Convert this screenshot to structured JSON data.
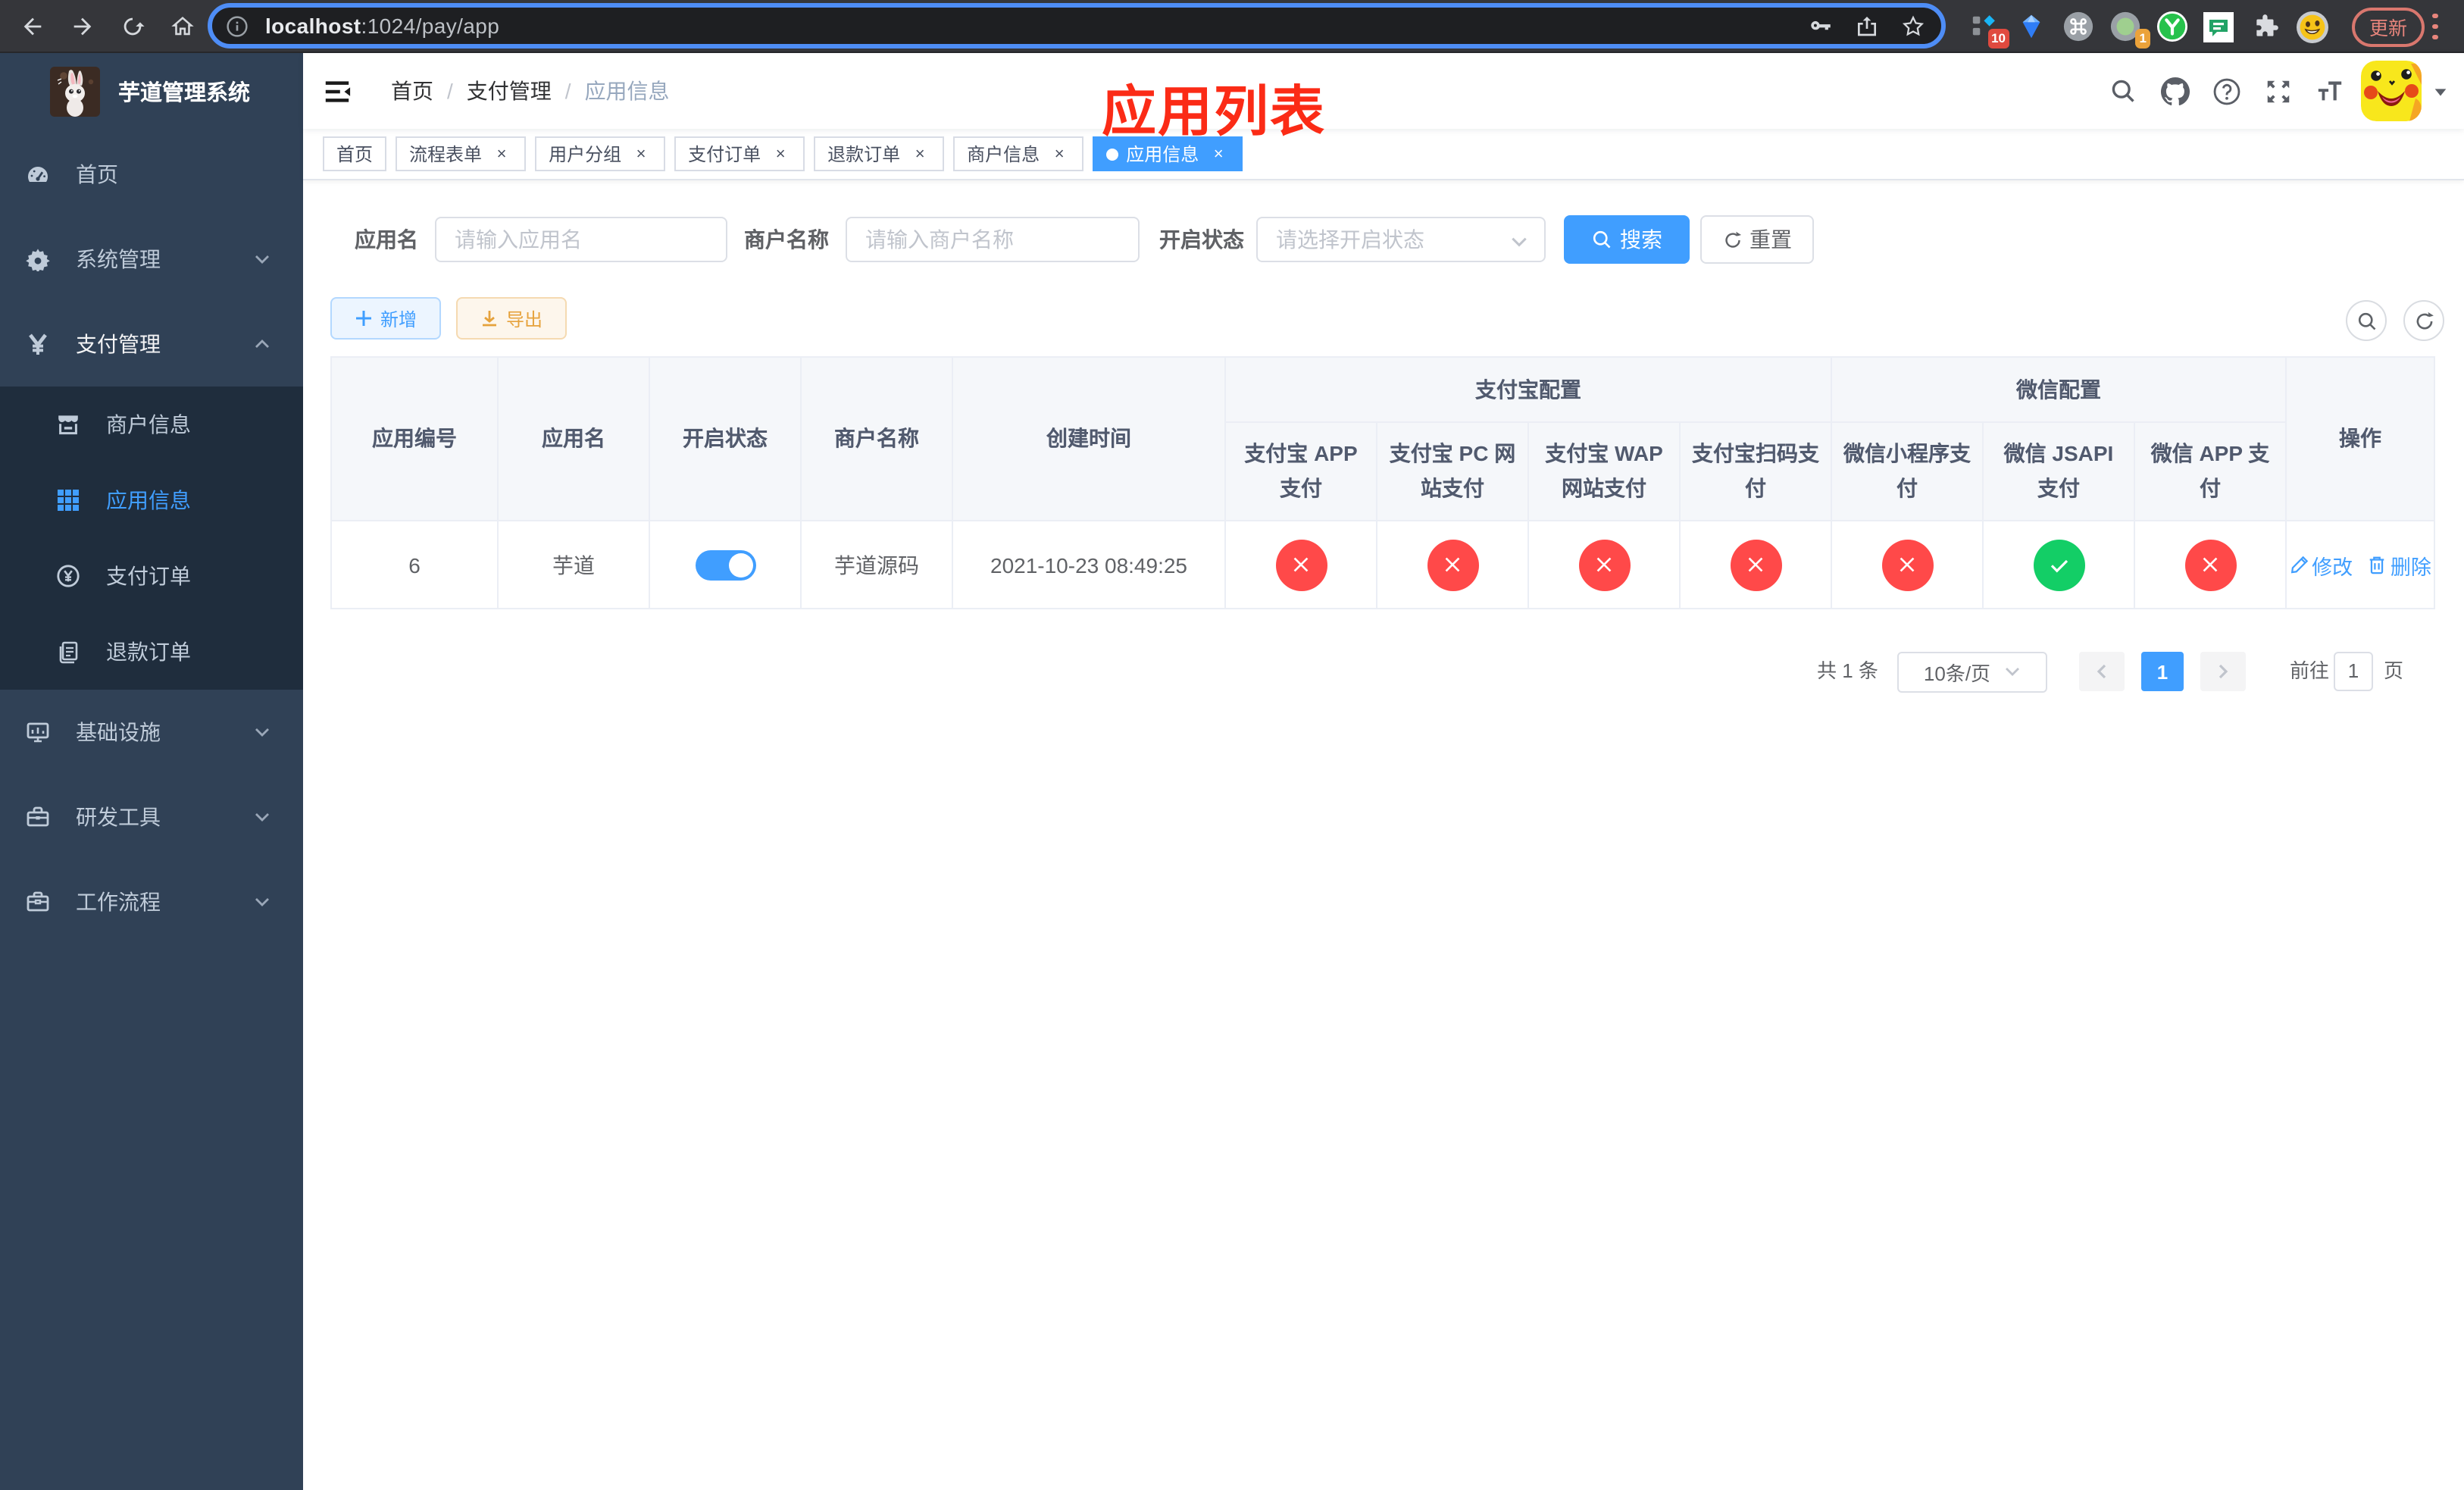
{
  "browser": {
    "url_host": "localhost",
    "url_rest": ":1024/pay/app",
    "update_label": "更新",
    "extension_badge_count": "10",
    "notification_badge_count": "1"
  },
  "sidebar": {
    "logo_title": "芋道管理系统",
    "items": [
      {
        "label": "首页",
        "icon": "dashboard-icon"
      },
      {
        "label": "系统管理",
        "icon": "gear-icon",
        "state": "collapsed"
      },
      {
        "label": "支付管理",
        "icon": "yen-icon",
        "state": "expanded"
      },
      {
        "label": "基础设施",
        "icon": "monitor-icon",
        "state": "collapsed"
      },
      {
        "label": "研发工具",
        "icon": "toolbox-icon",
        "state": "collapsed"
      },
      {
        "label": "工作流程",
        "icon": "briefcase-icon",
        "state": "collapsed"
      }
    ],
    "submenu": [
      {
        "label": "商户信息",
        "icon": "store-icon",
        "active": false
      },
      {
        "label": "应用信息",
        "icon": "grid-icon",
        "active": true
      },
      {
        "label": "支付订单",
        "icon": "coin-icon",
        "active": false
      },
      {
        "label": "退款订单",
        "icon": "document-icon",
        "active": false
      }
    ]
  },
  "navbar": {
    "breadcrumb": {
      "0": "首页",
      "1": "支付管理",
      "2": "应用信息",
      "separator": "/"
    },
    "annotation": "应用列表"
  },
  "tags": [
    {
      "label": "首页",
      "closable": false,
      "active": false
    },
    {
      "label": "流程表单",
      "closable": true,
      "active": false
    },
    {
      "label": "用户分组",
      "closable": true,
      "active": false
    },
    {
      "label": "支付订单",
      "closable": true,
      "active": false
    },
    {
      "label": "退款订单",
      "closable": true,
      "active": false
    },
    {
      "label": "商户信息",
      "closable": true,
      "active": false
    },
    {
      "label": "应用信息",
      "closable": true,
      "active": true
    }
  ],
  "filters": {
    "app_name_label": "应用名",
    "app_name_placeholder": "请输入应用名",
    "merchant_label": "商户名称",
    "merchant_placeholder": "请输入商户名称",
    "status_label": "开启状态",
    "status_placeholder": "请选择开启状态",
    "search_label": "搜索",
    "reset_label": "重置"
  },
  "toolbar": {
    "add_label": "新增",
    "export_label": "导出"
  },
  "table": {
    "headers": {
      "app_id": "应用编号",
      "app_name": "应用名",
      "status": "开启状态",
      "merchant": "商户名称",
      "created": "创建时间",
      "alipay_group": "支付宝配置",
      "wechat_group": "微信配置",
      "alipay_app": "支付宝 APP 支付",
      "alipay_pc": "支付宝 PC 网站支付",
      "alipay_wap": "支付宝 WAP 网站支付",
      "alipay_qr": "支付宝扫码支付",
      "wechat_lite": "微信小程序支付",
      "wechat_jsapi": "微信 JSAPI 支付",
      "wechat_app": "微信 APP 支付",
      "operation": "操作"
    },
    "row": {
      "app_id": "6",
      "app_name": "芋道",
      "status_on": true,
      "merchant": "芋道源码",
      "created": "2021-10-23 08:49:25",
      "configs": [
        "off",
        "off",
        "off",
        "off",
        "off",
        "on",
        "off"
      ],
      "edit_label": "修改",
      "delete_label": "删除"
    }
  },
  "pagination": {
    "total_text": "共 1 条",
    "page_size_text": "10条/页",
    "current_page": "1",
    "goto_label": "前往",
    "goto_value": "1",
    "page_unit": "页"
  },
  "colors": {
    "primary": "#409eff",
    "danger_circle": "#ff4949",
    "success_circle": "#13ce66",
    "sidebar_bg": "#304156",
    "submenu_bg": "#1f2d3d",
    "warning": "#e6a23c",
    "annotation_red": "#fb2b16"
  }
}
